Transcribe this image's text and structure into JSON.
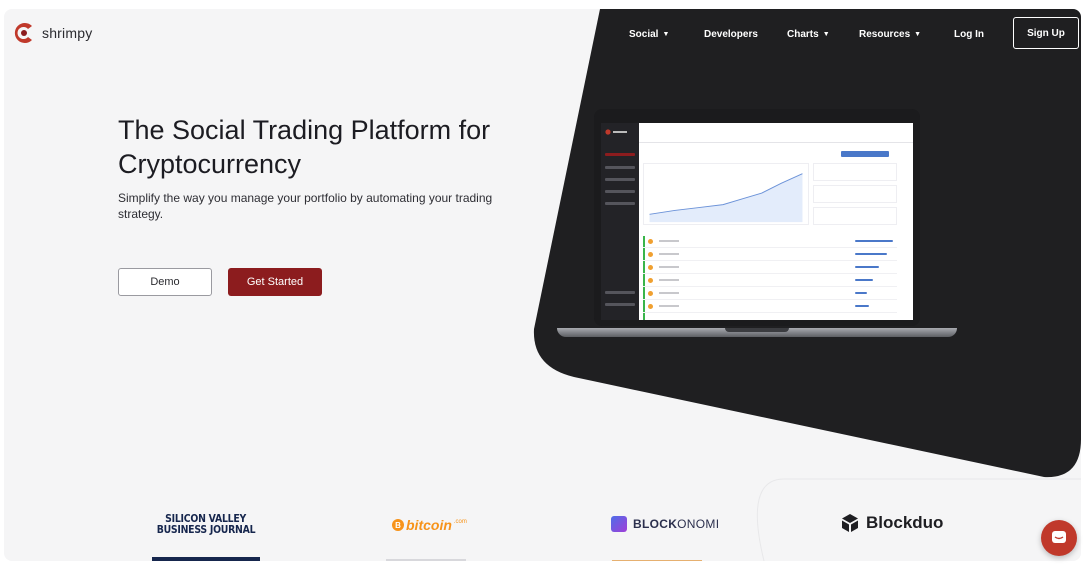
{
  "brand": {
    "name": "shrimpy",
    "accent": "#8c1c1e",
    "dark": "#1f1f21"
  },
  "nav": {
    "items": [
      {
        "label": "Social",
        "has_caret": true
      },
      {
        "label": "Developers",
        "has_caret": false
      },
      {
        "label": "Charts",
        "has_caret": true
      },
      {
        "label": "Resources",
        "has_caret": true
      },
      {
        "label": "Log In",
        "has_caret": false
      }
    ],
    "signup_label": "Sign Up"
  },
  "hero": {
    "title": "The Social Trading Platform for Cryptocurrency",
    "subtitle": "Simplify the way you manage your portfolio by automating your trading strategy.",
    "demo_label": "Demo",
    "get_started_label": "Get Started"
  },
  "press": {
    "svbj_line1": "SILICON VALLEY",
    "svbj_line2": "BUSINESS JOURNAL",
    "bitcoin_word": "bitcoin",
    "bitcoin_suffix": ".com",
    "bitcoin_letter": "B",
    "blockonomi_bold": "BLOCK",
    "blockonomi_rest": "ONOMI",
    "blockduo": "Blockduo"
  },
  "icons": {
    "logo": "shrimpy-logo-icon",
    "caret": "chevron-down-icon",
    "chat": "chat-bubble-icon",
    "blockduo": "cube-icon"
  }
}
